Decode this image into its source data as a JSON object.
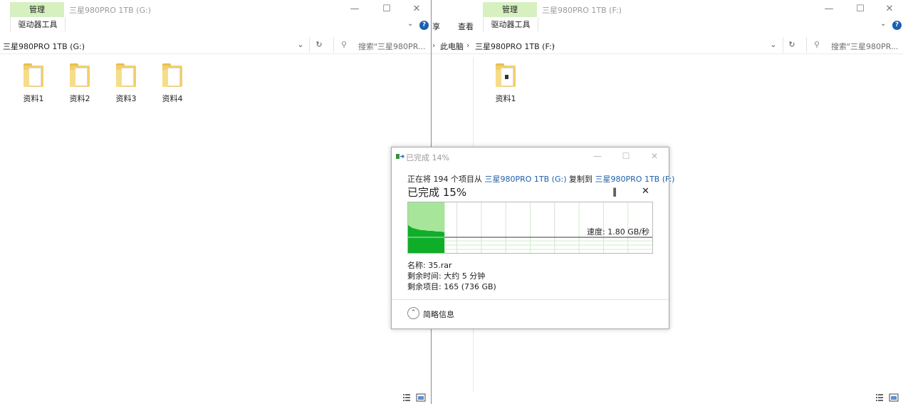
{
  "left_window": {
    "ribbon_group": "管理",
    "ribbon_tab": "驱动器工具",
    "title": "三星980PRO 1TB (G:)",
    "address": "三星980PRO 1TB (G:)",
    "search_placeholder": "搜索\"三星980PR...",
    "folders": [
      "资料1",
      "资料2",
      "资料3",
      "资料4"
    ]
  },
  "right_window": {
    "ribbon_group": "管理",
    "ribbon_tab": "驱动器工具",
    "title": "三星980PRO 1TB (F:)",
    "menu_partial": "享",
    "menu_view": "查看",
    "breadcrumb": [
      "此电脑",
      "三星980PRO 1TB (F:)"
    ],
    "search_placeholder": "搜索\"三星980PR...",
    "folders": [
      "资料1"
    ]
  },
  "progress_dialog": {
    "title": "已完成 14%",
    "line_prefix": "正在将 194 个项目从 ",
    "source": "三星980PRO 1TB (G:)",
    "line_mid": " 复制到 ",
    "destination": "三星980PRO 1TB (F:)",
    "percent_text": "已完成 15%",
    "progress": 0.15,
    "speed_text": "速度: 1.80 GB/秒",
    "name_line": "名称: 35.rar",
    "time_left_line": "剩余时间: 大约 5 分钟",
    "items_left_line": "剩余项目: 165 (736 GB)",
    "details_toggle": "简略信息"
  },
  "icons": {
    "help": "help-icon",
    "refresh": "refresh-icon",
    "search": "search-icon",
    "dropdown": "chevron-down-icon",
    "pause": "pause-icon",
    "cancel": "close-icon",
    "details_view": "details-view-icon",
    "thumbnail_view": "large-icons-view-icon"
  },
  "colors": {
    "ribbon_green": "#d6f0c0",
    "progress_fill": "#a6e59a",
    "throughput": "#0fae29",
    "link": "#1d5fa8"
  }
}
